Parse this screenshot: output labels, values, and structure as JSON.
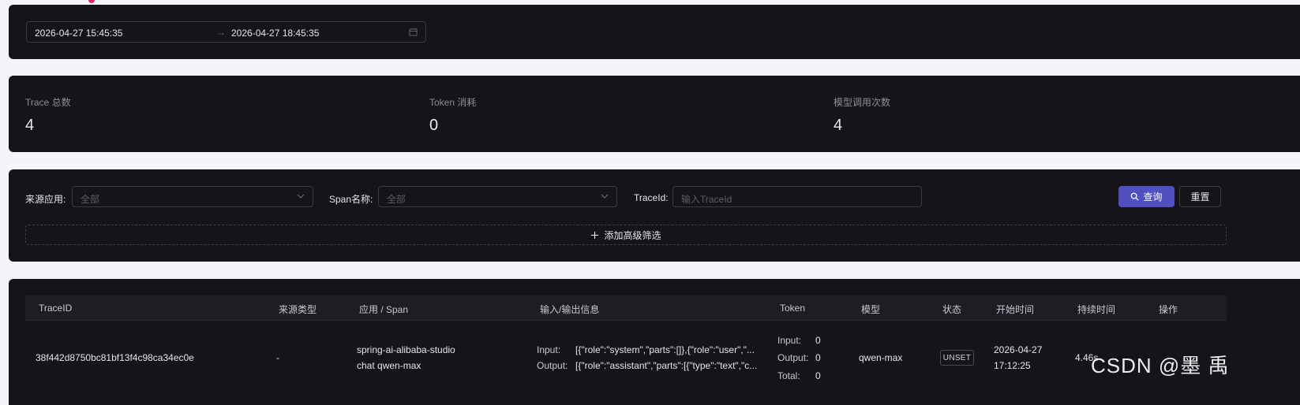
{
  "date_range": {
    "start": "2026-04-27 15:45:35",
    "separator": "→",
    "end": "2026-04-27 18:45:35"
  },
  "stats": [
    {
      "label": "Trace 总数",
      "value": "4"
    },
    {
      "label": "Token 消耗",
      "value": "0"
    },
    {
      "label": "模型调用次数",
      "value": "4"
    }
  ],
  "filters": {
    "source_app_label": "来源应用:",
    "source_app_placeholder": "全部",
    "span_name_label": "Span名称:",
    "span_name_placeholder": "全部",
    "traceid_label": "TraceId:",
    "traceid_placeholder": "输入TraceId",
    "query_label": "查询",
    "reset_label": "重置",
    "advanced_label": "添加高级筛选"
  },
  "table": {
    "columns": [
      "TraceID",
      "来源类型",
      "应用 / Span",
      "输入/输出信息",
      "Token",
      "模型",
      "状态",
      "开始时间",
      "持续时间",
      "操作"
    ],
    "rows": [
      {
        "trace_id": "38f442d8750bc81bf13f4c98ca34ec0e",
        "source_type": "-",
        "app": "spring-ai-alibaba-studio",
        "span": "chat qwen-max",
        "input_label": "Input:",
        "input_value": "[{\"role\":\"system\",\"parts\":[]},{\"role\":\"user\",\"...",
        "output_label": "Output:",
        "output_value": "[{\"role\":\"assistant\",\"parts\":[{\"type\":\"text\",\"c...",
        "token_input_label": "Input:",
        "token_input": "0",
        "token_output_label": "Output:",
        "token_output": "0",
        "token_total_label": "Total:",
        "token_total": "0",
        "model": "qwen-max",
        "status": "UNSET",
        "start_date": "2026-04-27",
        "start_time": "17:12:25",
        "duration": "4.46s"
      }
    ]
  },
  "watermark": "CSDN @墨 禹",
  "colors": {
    "panel_bg": "#141419",
    "page_bg": "#f4f5f8",
    "accent": "#5050c0",
    "indicator_dot": "#e0286e"
  }
}
